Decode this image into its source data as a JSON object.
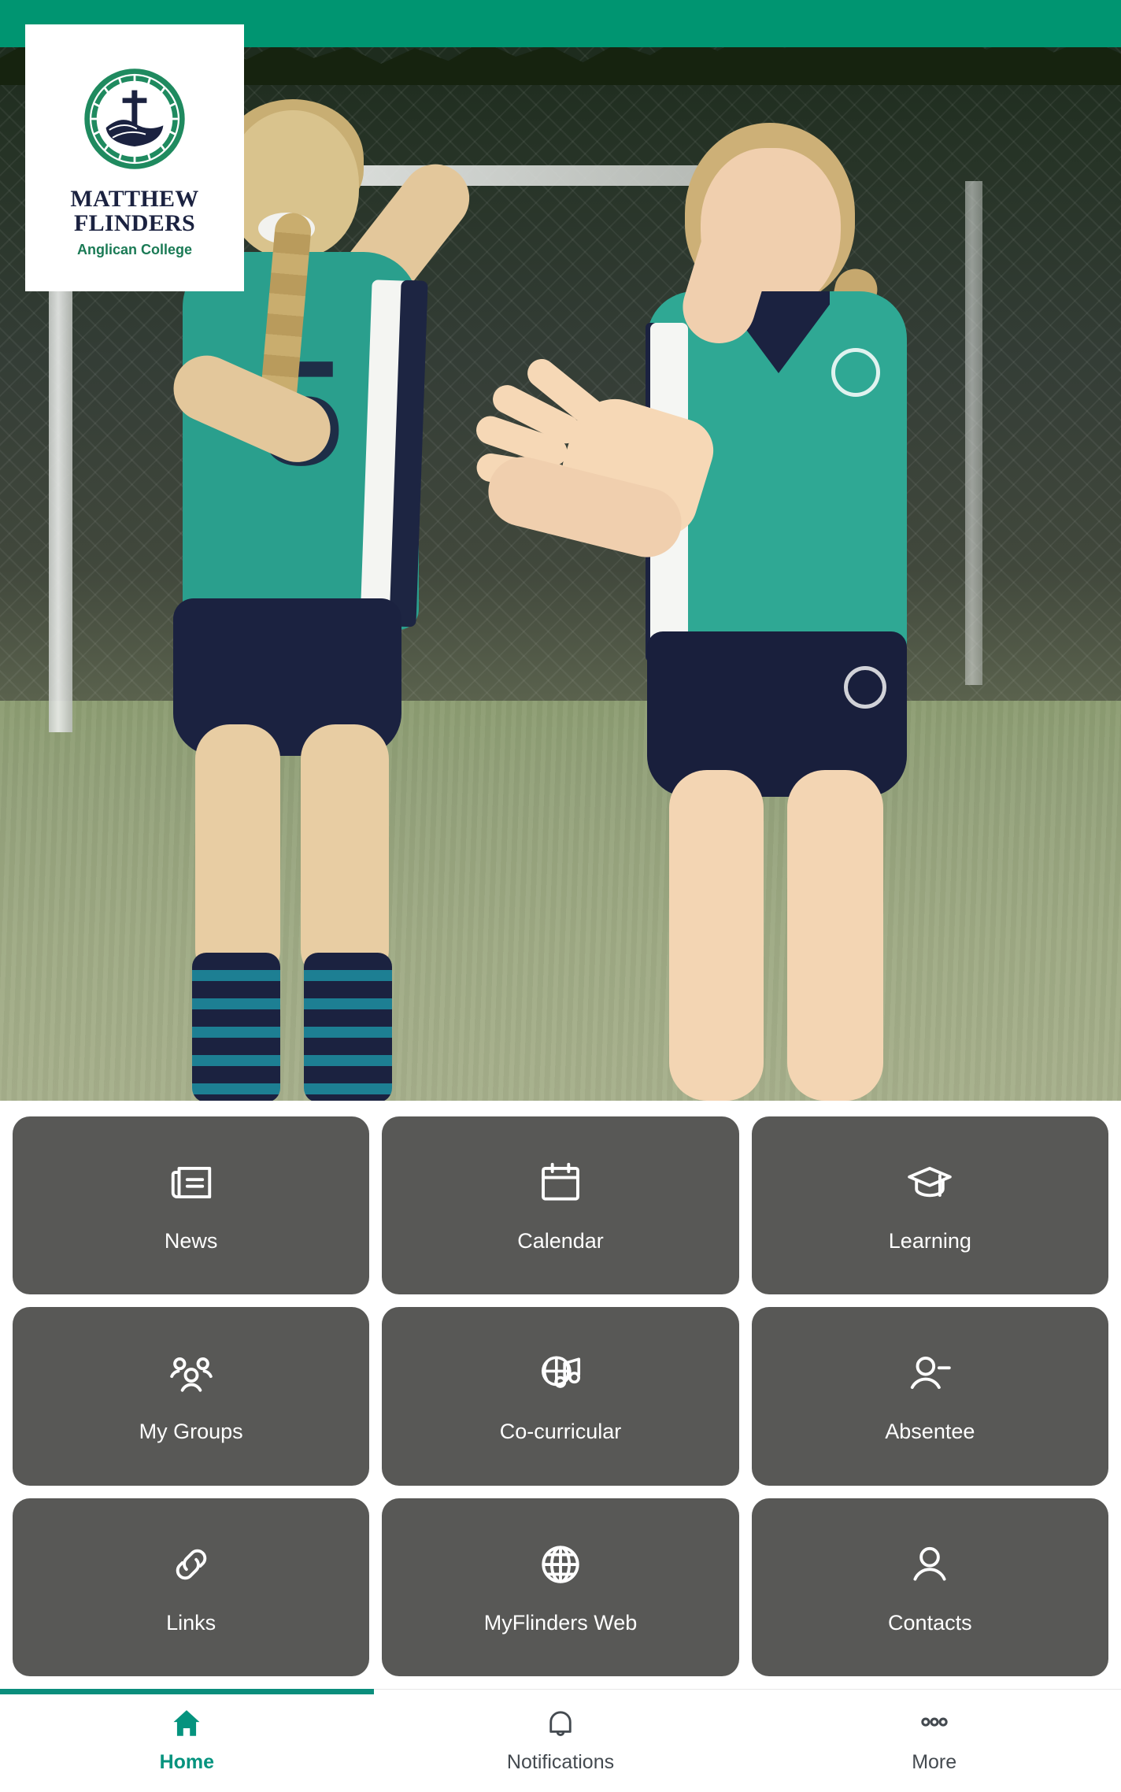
{
  "brand": {
    "logo_title_line1": "MATTHEW",
    "logo_title_line2": "FLINDERS",
    "logo_subtitle": "Anglican College",
    "accent_green": "#009571",
    "navy": "#1b2240",
    "tile_gray": "#585856",
    "nav_active_teal": "#05937e"
  },
  "hero": {
    "alt": "Two students in teal sports uniforms high-fiving on a sports field"
  },
  "tiles": [
    {
      "label": "News",
      "icon": "newspaper-icon"
    },
    {
      "label": "Calendar",
      "icon": "calendar-icon"
    },
    {
      "label": "Learning",
      "icon": "graduation-cap-icon"
    },
    {
      "label": "My Groups",
      "icon": "people-group-icon"
    },
    {
      "label": "Co-curricular",
      "icon": "basketball-music-icon"
    },
    {
      "label": "Absentee",
      "icon": "user-minus-icon"
    },
    {
      "label": "Links",
      "icon": "chain-link-icon"
    },
    {
      "label": "MyFlinders Web",
      "icon": "globe-icon"
    },
    {
      "label": "Contacts",
      "icon": "user-icon"
    }
  ],
  "bottom_nav": {
    "active_index": 0,
    "items": [
      {
        "label": "Home",
        "icon": "home-icon"
      },
      {
        "label": "Notifications",
        "icon": "bell-icon"
      },
      {
        "label": "More",
        "icon": "ellipsis-icon"
      }
    ]
  }
}
